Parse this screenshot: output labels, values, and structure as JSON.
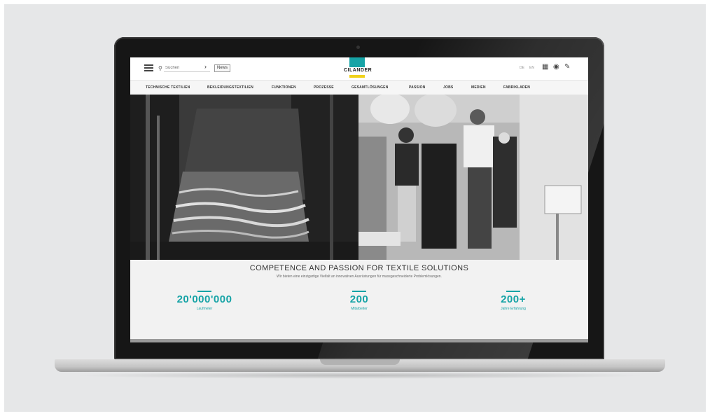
{
  "header": {
    "search_placeholder": "Suchen",
    "news_label": "News",
    "logo_text": "CILANDER",
    "lang_options": [
      "DE",
      "EN"
    ]
  },
  "nav": {
    "items": [
      "TECHNISCHE TEXTILIEN",
      "BEKLEIDUNGSTEXTILIEN",
      "FUNKTIONEN",
      "PROZESSE",
      "GESAMTLÖSUNGEN",
      "PASSION",
      "JOBS",
      "MEDIEN",
      "FABRIKLADEN"
    ]
  },
  "content": {
    "headline": "COMPETENCE AND PASSION FOR TEXTILE SOLUTIONS",
    "subline": "Wir bieten eine einzigartige Vielfalt an innovativen Ausrüstungen für massgeschneiderte Problemlösungen.",
    "stats": [
      {
        "value": "20'000'000",
        "label": "Laufmeter"
      },
      {
        "value": "200",
        "label": "Mitarbeiter"
      },
      {
        "value": "200+",
        "label": "Jahre Erfahrung"
      }
    ]
  },
  "colors": {
    "brand_teal": "#16a3a6",
    "brand_yellow": "#f0d21b"
  },
  "icons": [
    "hamburger-menu-icon",
    "search-icon",
    "chevron-right-icon",
    "grid-icon",
    "location-pin-icon",
    "pencil-icon"
  ]
}
